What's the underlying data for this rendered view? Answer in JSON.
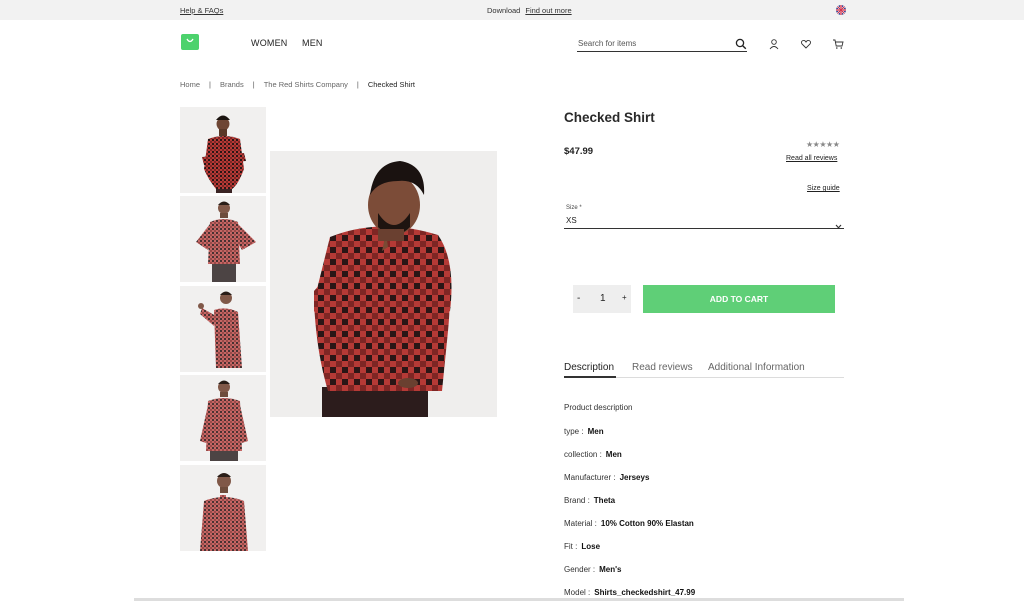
{
  "topbar": {
    "help": "Help & FAQs",
    "download": "Download",
    "find_out": "Find out more"
  },
  "nav": {
    "women": "WOMEN",
    "men": "MEN"
  },
  "search": {
    "placeholder": "Search for items"
  },
  "icons": [
    "logo-bag-icon",
    "search-icon",
    "user-icon",
    "heart-icon",
    "cart-icon",
    "uk-flag-icon",
    "chevron-down-icon"
  ],
  "breadcrumb": [
    "Home",
    "Brands",
    "The Red Shirts Company",
    "Checked Shirt"
  ],
  "product": {
    "title": "Checked Shirt",
    "price": "$47.99",
    "stars": "★★★★★",
    "read_all": "Read all reviews",
    "size_guide": "Size guide",
    "size_label": "Size *",
    "size_value": "XS",
    "qty_minus": "-",
    "qty_value": "1",
    "qty_plus": "+",
    "add_to_cart": "ADD TO CART"
  },
  "tabs": [
    "Description",
    "Read reviews",
    "Additional Information"
  ],
  "description": {
    "heading": "Product description",
    "rows": [
      {
        "label": "type :",
        "value": "Men"
      },
      {
        "label": "collection :",
        "value": "Men"
      },
      {
        "label": "Manufacturer :",
        "value": "Jerseys"
      },
      {
        "label": "Brand :",
        "value": "Theta"
      },
      {
        "label": "Material :",
        "value": "10% Cotton 90% Elastan"
      },
      {
        "label": "Fit :",
        "value": "Lose"
      },
      {
        "label": "Gender :",
        "value": "Men's"
      },
      {
        "label": "Model :",
        "value": "Shirts_checkedshirt_47.99"
      }
    ]
  },
  "colors": {
    "accent": "#5fcf77",
    "logo": "#4cd26c",
    "topbar": "#f2f2f2",
    "shirt": "#b53a36"
  }
}
